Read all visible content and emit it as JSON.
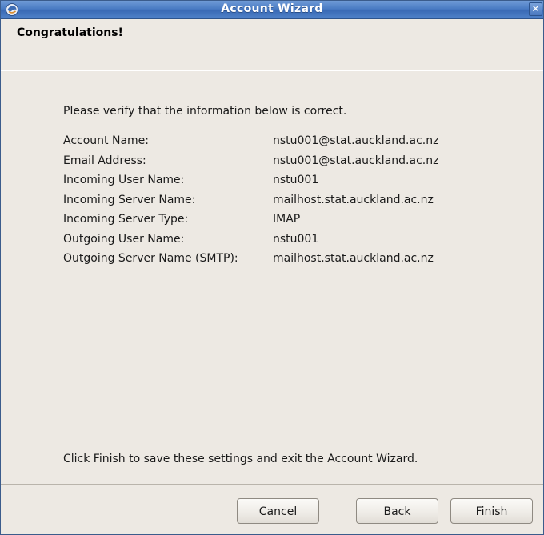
{
  "window": {
    "title": "Account Wizard",
    "close_symbol": "✕"
  },
  "page": {
    "heading": "Congratulations!",
    "intro": "Please verify that the information below is correct.",
    "footer": "Click Finish to save these settings and exit the Account Wizard."
  },
  "info": [
    {
      "label": "Account Name:",
      "value": "nstu001@stat.auckland.ac.nz"
    },
    {
      "label": "Email Address:",
      "value": "nstu001@stat.auckland.ac.nz"
    },
    {
      "label": "Incoming User Name:",
      "value": "nstu001"
    },
    {
      "label": "Incoming Server Name:",
      "value": "mailhost.stat.auckland.ac.nz"
    },
    {
      "label": "Incoming Server Type:",
      "value": "IMAP"
    },
    {
      "label": "Outgoing User Name:",
      "value": "nstu001"
    },
    {
      "label": "Outgoing Server Name (SMTP):",
      "value": "mailhost.stat.auckland.ac.nz"
    }
  ],
  "buttons": {
    "cancel": "Cancel",
    "back": "Back",
    "finish": "Finish"
  },
  "colors": {
    "titlebar": "#4a7cc4",
    "background": "#ede9e3"
  },
  "icons": {
    "app": "thunderbird-icon",
    "close": "close-icon"
  }
}
